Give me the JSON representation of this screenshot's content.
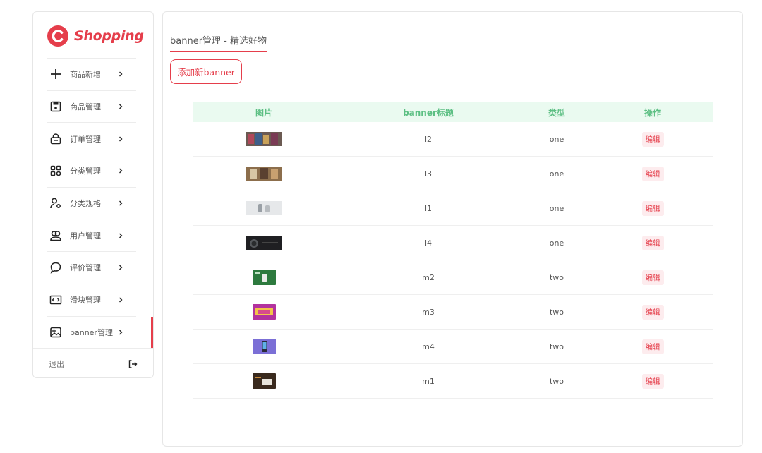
{
  "brand": {
    "name": "Shopping",
    "color": "#e53e4b",
    "icon": "c-logo-icon"
  },
  "sidebar": {
    "items": [
      {
        "label": "商品新增",
        "icon": "plus-icon"
      },
      {
        "label": "商品管理",
        "icon": "save-icon"
      },
      {
        "label": "订单管理",
        "icon": "bag-icon"
      },
      {
        "label": "分类管理",
        "icon": "grid-icon"
      },
      {
        "label": "分类规格",
        "icon": "user-location-icon"
      },
      {
        "label": "用户管理",
        "icon": "users-icon"
      },
      {
        "label": "评价管理",
        "icon": "comment-icon"
      },
      {
        "label": "滑块管理",
        "icon": "code-icon"
      },
      {
        "label": "banner管理",
        "icon": "image-icon",
        "active": true
      }
    ],
    "logout_label": "退出",
    "logout_icon": "logout-icon"
  },
  "main": {
    "title": "banner管理 - 精选好物",
    "add_button": "添加新banner",
    "table": {
      "headers": [
        "图片",
        "banner标题",
        "类型",
        "操作"
      ],
      "header_color": "#5cbf83",
      "rows": [
        {
          "image": "banner-thumb-l2",
          "title": "l2",
          "type": "one",
          "action": "编辑"
        },
        {
          "image": "banner-thumb-l3",
          "title": "l3",
          "type": "one",
          "action": "编辑"
        },
        {
          "image": "banner-thumb-l1",
          "title": "l1",
          "type": "one",
          "action": "编辑"
        },
        {
          "image": "banner-thumb-l4",
          "title": "l4",
          "type": "one",
          "action": "编辑"
        },
        {
          "image": "banner-thumb-m2",
          "title": "m2",
          "type": "two",
          "action": "编辑"
        },
        {
          "image": "banner-thumb-m3",
          "title": "m3",
          "type": "two",
          "action": "编辑"
        },
        {
          "image": "banner-thumb-m4",
          "title": "m4",
          "type": "two",
          "action": "编辑"
        },
        {
          "image": "banner-thumb-m1",
          "title": "m1",
          "type": "two",
          "action": "编辑"
        }
      ]
    }
  }
}
